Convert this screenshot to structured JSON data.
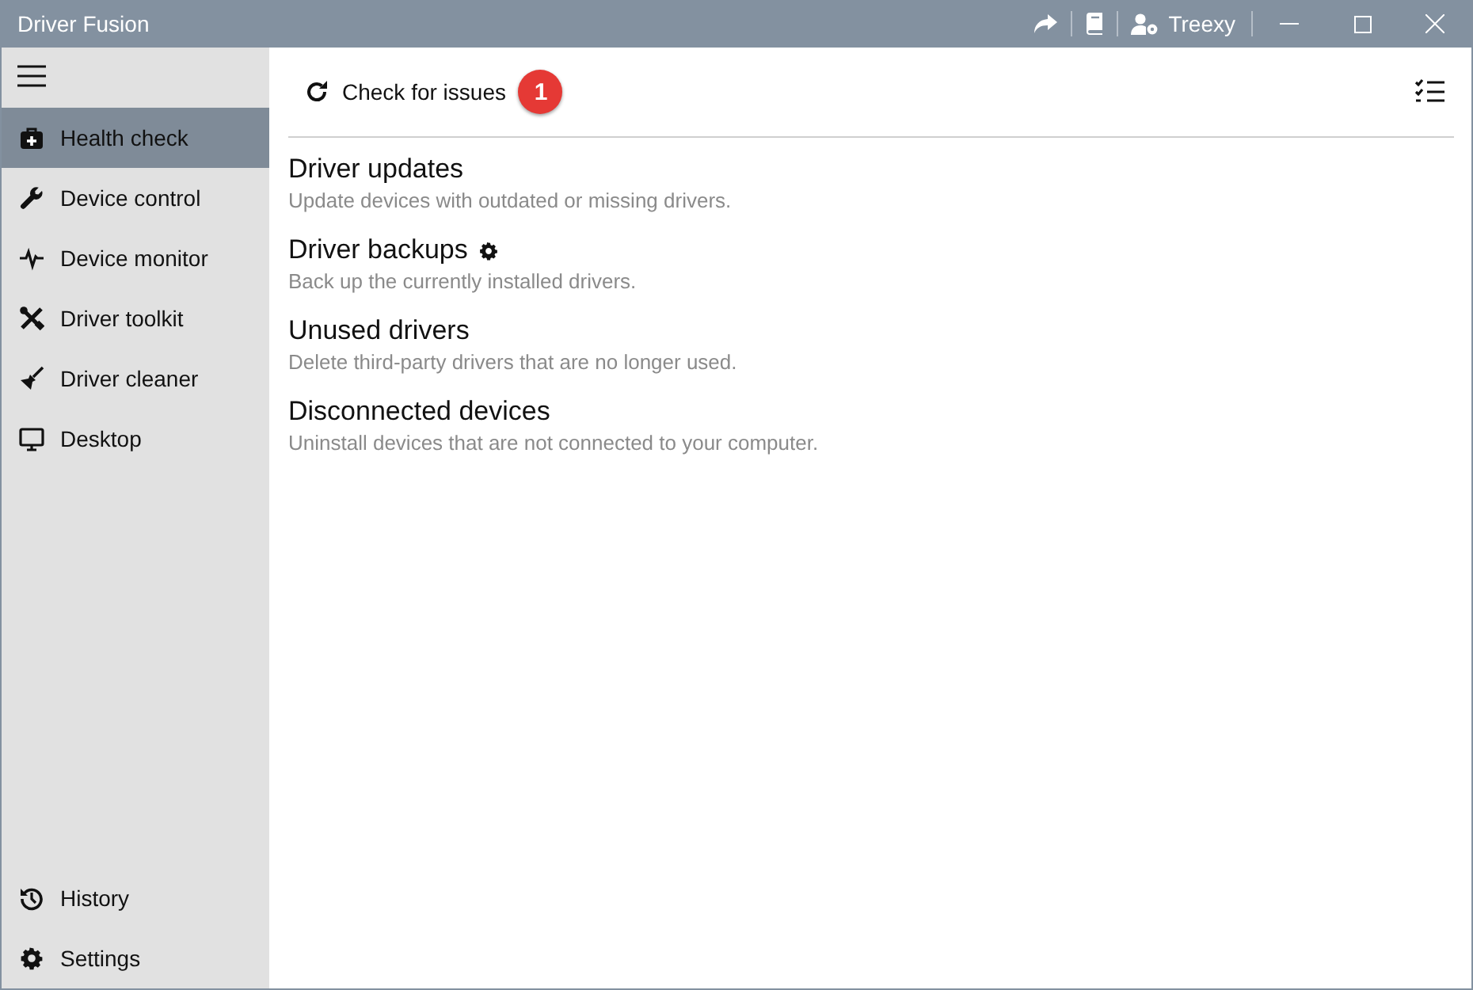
{
  "window": {
    "title": "Driver Fusion",
    "user": "Treexy"
  },
  "sidebar": {
    "items": [
      {
        "label": "Health check",
        "selected": true
      },
      {
        "label": "Device control",
        "selected": false
      },
      {
        "label": "Device monitor",
        "selected": false
      },
      {
        "label": "Driver toolkit",
        "selected": false
      },
      {
        "label": "Driver cleaner",
        "selected": false
      },
      {
        "label": "Desktop",
        "selected": false
      }
    ],
    "bottom_items": [
      {
        "label": "History",
        "selected": false
      },
      {
        "label": "Settings",
        "selected": false
      }
    ]
  },
  "toolbar": {
    "check_button": "Check for issues",
    "badge": "1"
  },
  "sections": [
    {
      "title": "Driver updates",
      "description": "Update devices with outdated or missing drivers.",
      "settings_icon": false
    },
    {
      "title": "Driver backups",
      "description": "Back up the currently installed drivers.",
      "settings_icon": true
    },
    {
      "title": "Unused drivers",
      "description": "Delete third-party drivers that are no longer used.",
      "settings_icon": false
    },
    {
      "title": "Disconnected devices",
      "description": "Uninstall devices that are not connected to your computer.",
      "settings_icon": false
    }
  ]
}
